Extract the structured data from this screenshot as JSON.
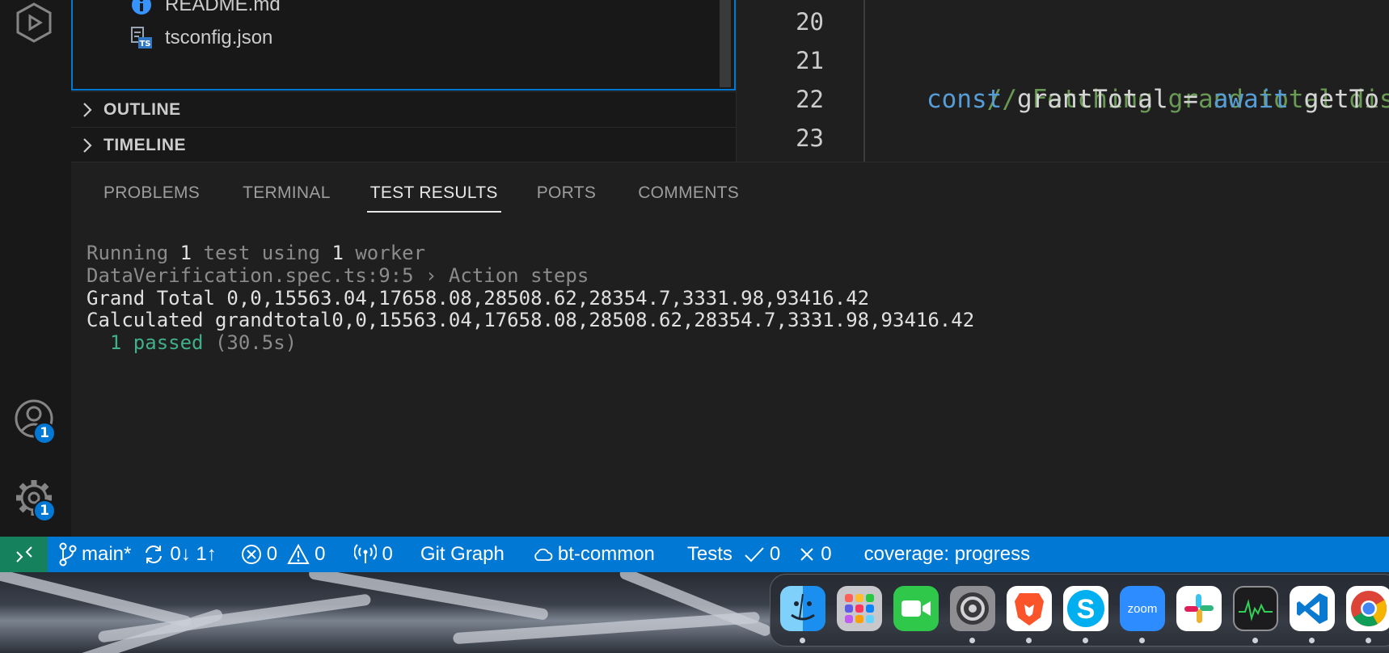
{
  "activity_bar": {
    "accounts_badge": "1",
    "settings_badge": "1"
  },
  "explorer": {
    "files": [
      {
        "name": "README.md",
        "icon": "info-icon"
      },
      {
        "name": "tsconfig.json",
        "icon": "ts-config-icon"
      }
    ],
    "sections": [
      {
        "label": "OUTLINE"
      },
      {
        "label": "TIMELINE"
      }
    ]
  },
  "editor": {
    "lines": [
      {
        "number": "20",
        "segments": []
      },
      {
        "number": "21",
        "segments": [
          {
            "text": "// Fetching grand total displa",
            "type": "comment"
          }
        ]
      },
      {
        "number": "22",
        "segments": [
          {
            "text": "const",
            "type": "keyword"
          },
          {
            "text": " grantTotal = ",
            "type": "text"
          },
          {
            "text": "await",
            "type": "keyword"
          },
          {
            "text": " getTo",
            "type": "text"
          }
        ]
      },
      {
        "number": "23",
        "segments": []
      }
    ]
  },
  "panel": {
    "tabs": [
      "PROBLEMS",
      "TERMINAL",
      "TEST RESULTS",
      "PORTS",
      "COMMENTS"
    ],
    "active_tab": "TEST RESULTS",
    "output": {
      "line1": {
        "a": "Running ",
        "b": "1",
        "c": " test using ",
        "d": "1",
        "e": " worker"
      },
      "line2": "DataVerification.spec.ts:9:5 › Action steps",
      "line3": "Grand Total 0,0,15563.04,17658.08,28508.62,28354.7,3331.98,93416.42",
      "line4": "Calculated grandtotal0,0,15563.04,17658.08,28508.62,28354.7,3331.98,93416.42",
      "line5": {
        "passed": "  1 passed",
        "time": " (30.5s)"
      }
    }
  },
  "status_bar": {
    "branch": "main*",
    "sync": "0↓ 1↑",
    "errors": "0",
    "warnings": "0",
    "ports": "0",
    "git_graph": "Git Graph",
    "cloud": "bt-common",
    "tests_label": "Tests",
    "tests_passed": "0",
    "tests_failed": "0",
    "coverage": "coverage: progress"
  },
  "dock": {
    "apps": [
      "finder-icon",
      "launchpad-icon",
      "facetime-icon",
      "system-settings-icon",
      "brave-icon",
      "skype-icon",
      "zoom-icon",
      "slack-icon",
      "activity-monitor-icon",
      "vscode-icon",
      "chrome-icon"
    ],
    "zoom_label": "zoom"
  },
  "colors": {
    "accent": "#0078d4",
    "remote": "#16825d",
    "passed": "#3fb08a",
    "comment": "#6a9955",
    "keyword": "#569cd6"
  }
}
